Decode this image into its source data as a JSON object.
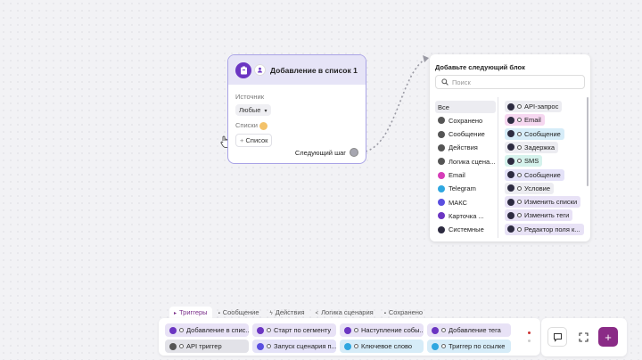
{
  "node": {
    "title": "Добавление в список 1",
    "source_label": "Источник",
    "source_value": "Любые",
    "lists_label": "Списки",
    "add_list": "Список",
    "next_step": "Следующий шаг"
  },
  "panel": {
    "title": "Добавьте следующий блок",
    "search_placeholder": "Поиск",
    "categories": [
      {
        "label": "Все",
        "color": "#ececf1"
      },
      {
        "label": "Сохранено",
        "color": "#555"
      },
      {
        "label": "Сообщение",
        "color": "#555"
      },
      {
        "label": "Действия",
        "color": "#555"
      },
      {
        "label": "Логика сцена...",
        "color": "#555"
      },
      {
        "label": "Email",
        "color": "#d63db8"
      },
      {
        "label": "Telegram",
        "color": "#2fa7e0"
      },
      {
        "label": "МАКС",
        "color": "#5a4ee0"
      },
      {
        "label": "Карточка ...",
        "color": "#6b35c2"
      },
      {
        "label": "Системные",
        "color": "#2d2b40"
      }
    ],
    "blocks": [
      {
        "label": "API-запрос",
        "bg": "#ececf1"
      },
      {
        "label": "Email",
        "bg": "#f6d7f0"
      },
      {
        "label": "Сообщение",
        "bg": "#d6ecf8"
      },
      {
        "label": "Задержка",
        "bg": "#ececf1"
      },
      {
        "label": "SMS",
        "bg": "#d5f2ec"
      },
      {
        "label": "Сообщение",
        "bg": "#e4e2f8"
      },
      {
        "label": "Условие",
        "bg": "#ececf1"
      },
      {
        "label": "Изменить списки",
        "bg": "#e8e2f6"
      },
      {
        "label": "Изменить теги",
        "bg": "#e8e2f6"
      },
      {
        "label": "Редактор поля к...",
        "bg": "#e8e2f6"
      }
    ]
  },
  "tabs": [
    {
      "label": "Триггеры",
      "icon": "▸",
      "active": true
    },
    {
      "label": "Сообщение",
      "icon": "▪"
    },
    {
      "label": "Действия",
      "icon": "ϟ"
    },
    {
      "label": "Логика сценария",
      "icon": "<"
    },
    {
      "label": "Сохранено",
      "icon": "▪"
    }
  ],
  "triggers": [
    {
      "label": "Добавление в спис...",
      "bg": "#e8e2f6",
      "icon_color": "#6b35c2"
    },
    {
      "label": "Старт по сегменту",
      "bg": "#e8e2f6",
      "icon_color": "#6b35c2"
    },
    {
      "label": "Наступление собы...",
      "bg": "#e8e2f6",
      "icon_color": "#6b35c2"
    },
    {
      "label": "Добавление тега",
      "bg": "#e8e2f6",
      "icon_color": "#6b35c2"
    },
    {
      "label": "API триггер",
      "bg": "#e2e2e8",
      "icon_color": "#555"
    },
    {
      "label": "Запуск сценария п...",
      "bg": "#e4e2f8",
      "icon_color": "#5a4ee0"
    },
    {
      "label": "Ключевое слово",
      "bg": "#d6ecf8",
      "icon_color": "#2fa7e0"
    },
    {
      "label": "Триггер по ссылке",
      "bg": "#d6ecf8",
      "icon_color": "#2fa7e0"
    }
  ],
  "colors": {
    "accent": "#6b35c2",
    "add_button": "#8a2b86"
  }
}
